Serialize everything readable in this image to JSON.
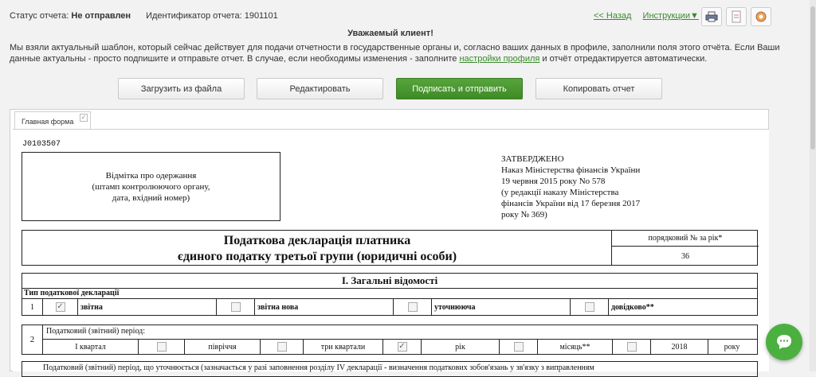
{
  "status": {
    "label": "Статус отчета:",
    "value": "Не отправлен",
    "id_label": "Идентификатор отчета:",
    "id_value": "1901101"
  },
  "toplinks": {
    "back": "<< Назад",
    "instructions": "Инструкции▼"
  },
  "notice": {
    "title": "Уважаемый клиент!",
    "text1": "Мы взяли актуальный шаблон, который сейчас действует для подачи отчетности в государственные органы и, согласно ваших данных в профиле, заполнили поля этого отчёта. Если Ваши данные актуальны - просто подпишите и отправьте отчет. В случае, если необходимы изменения - заполните ",
    "link": "настройки профиля",
    "text2": " и отчёт отредактируется автоматически."
  },
  "buttons": {
    "load": "Загрузить из файла",
    "edit": "Редактировать",
    "sign": "Подписать и отправить",
    "copy": "Копировать отчет"
  },
  "tab": {
    "label": "Главная форма"
  },
  "form": {
    "code": "J0103507",
    "stamp": [
      "Відмітка про одержання",
      "(штамп контролюючого органу,",
      "дата, вхідний номер)"
    ],
    "approved": [
      "ЗАТВЕРДЖЕНО",
      "Наказ Міністерства фінансів України",
      "19 червня 2015 року No 578",
      "(у редакції наказу Міністерства",
      "фінансів України від 17 березня 2017",
      "року № 369)"
    ],
    "title1": "Податкова декларація платника",
    "title2": "єдиного податку третьої групи (юридичні особи)",
    "order_label": "порядковий № за рік*",
    "order_value": "36",
    "section1": "I. Загальні відомості",
    "type_label": "Тип податкової декларації",
    "row1_num": "1",
    "types": [
      "звітна",
      "звітна нова",
      "уточнююча",
      "довідково**"
    ],
    "row2_num": "2",
    "period_label": "Податковий (звітний) період:",
    "periods": [
      "I квартал",
      "півріччя",
      "три квартали",
      "рік",
      "місяць**"
    ],
    "year": "2018",
    "year_suffix": "року",
    "bottom_text": "Податковий (звітний) період, що уточнюється (зазначається у разі заповнення розділу IV декларації - визначення податкових зобов'язань у зв'язку з виправленням"
  }
}
